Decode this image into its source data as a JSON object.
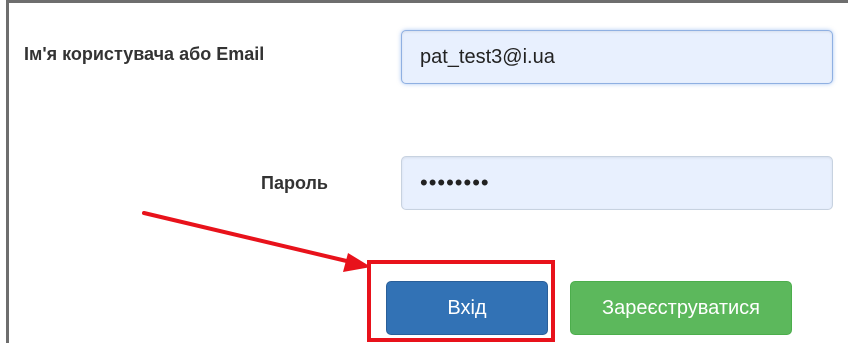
{
  "form": {
    "username_label": "Ім'я користувача або Email",
    "username_value": "pat_test3@i.ua",
    "password_label": "Пароль",
    "password_value": "passw0rd"
  },
  "buttons": {
    "login_label": "Вхід",
    "register_label": "Зареєструватися"
  },
  "annotation": {
    "arrow_color": "#e8121b",
    "highlight_color": "#e8121b",
    "highlight_target": "login-button"
  },
  "colors": {
    "login_button": "#3272b5",
    "register_button": "#5cb85c",
    "input_background": "#e8f0fe"
  }
}
